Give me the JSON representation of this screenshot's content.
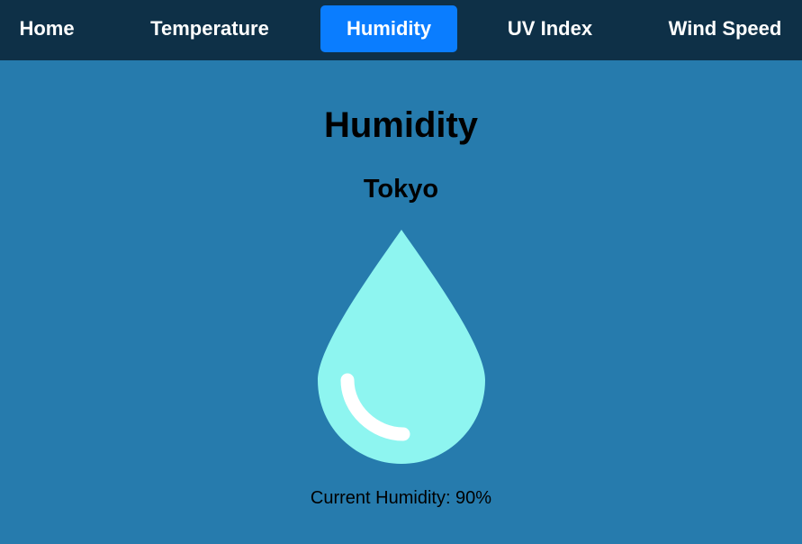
{
  "nav": {
    "items": [
      {
        "label": "Home"
      },
      {
        "label": "Temperature"
      },
      {
        "label": "Humidity"
      },
      {
        "label": "UV Index"
      },
      {
        "label": "Wind Speed"
      }
    ],
    "active_index": 2,
    "active_color": "#0a7dff",
    "bar_color": "#0e3047"
  },
  "main": {
    "title": "Humidity",
    "city": "Tokyo",
    "drop_icon": "water-drop-icon",
    "drop_color": "#8ef5f0",
    "reading_label": "Current Humidity: 90%"
  },
  "colors": {
    "background": "#267bad"
  }
}
